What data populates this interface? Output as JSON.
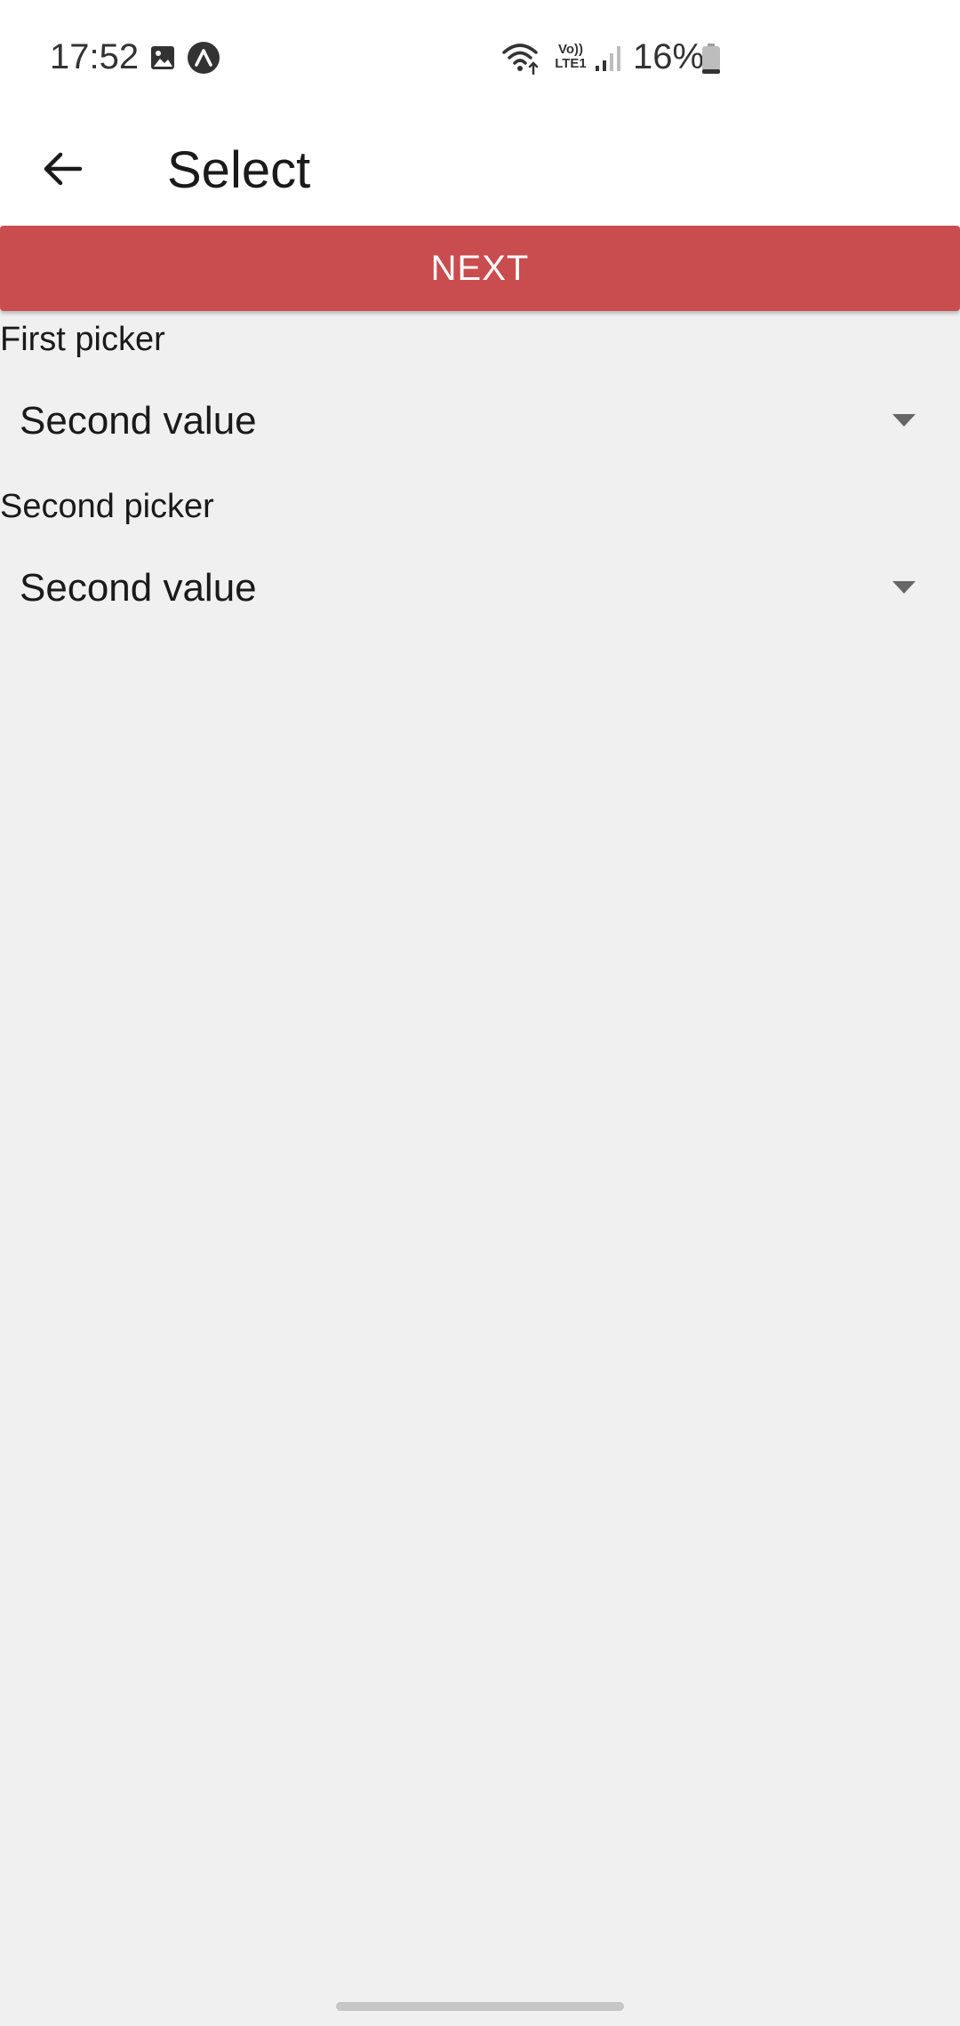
{
  "status_bar": {
    "time": "17:52",
    "battery_percent": "16%",
    "icons": [
      "image-icon",
      "expo-icon",
      "wifi-icon",
      "volte-lte1-icon",
      "signal-icon",
      "battery-icon"
    ],
    "network_label_top": "Vo))",
    "network_label_bottom": "LTE1",
    "battery_level": 0.16
  },
  "app_bar": {
    "back_icon": "arrow-left-icon",
    "title": "Select"
  },
  "actions": {
    "next_label": "NEXT"
  },
  "pickers": [
    {
      "label": "First picker",
      "selected": "Second value",
      "icon": "dropdown-arrow-icon"
    },
    {
      "label": "Second picker",
      "selected": "Second value",
      "icon": "dropdown-arrow-icon"
    }
  ],
  "colors": {
    "accent": "#c94c4f",
    "background": "#f0f0f0",
    "app_bar": "#ffffff",
    "dropdown_arrow": "#666666"
  }
}
